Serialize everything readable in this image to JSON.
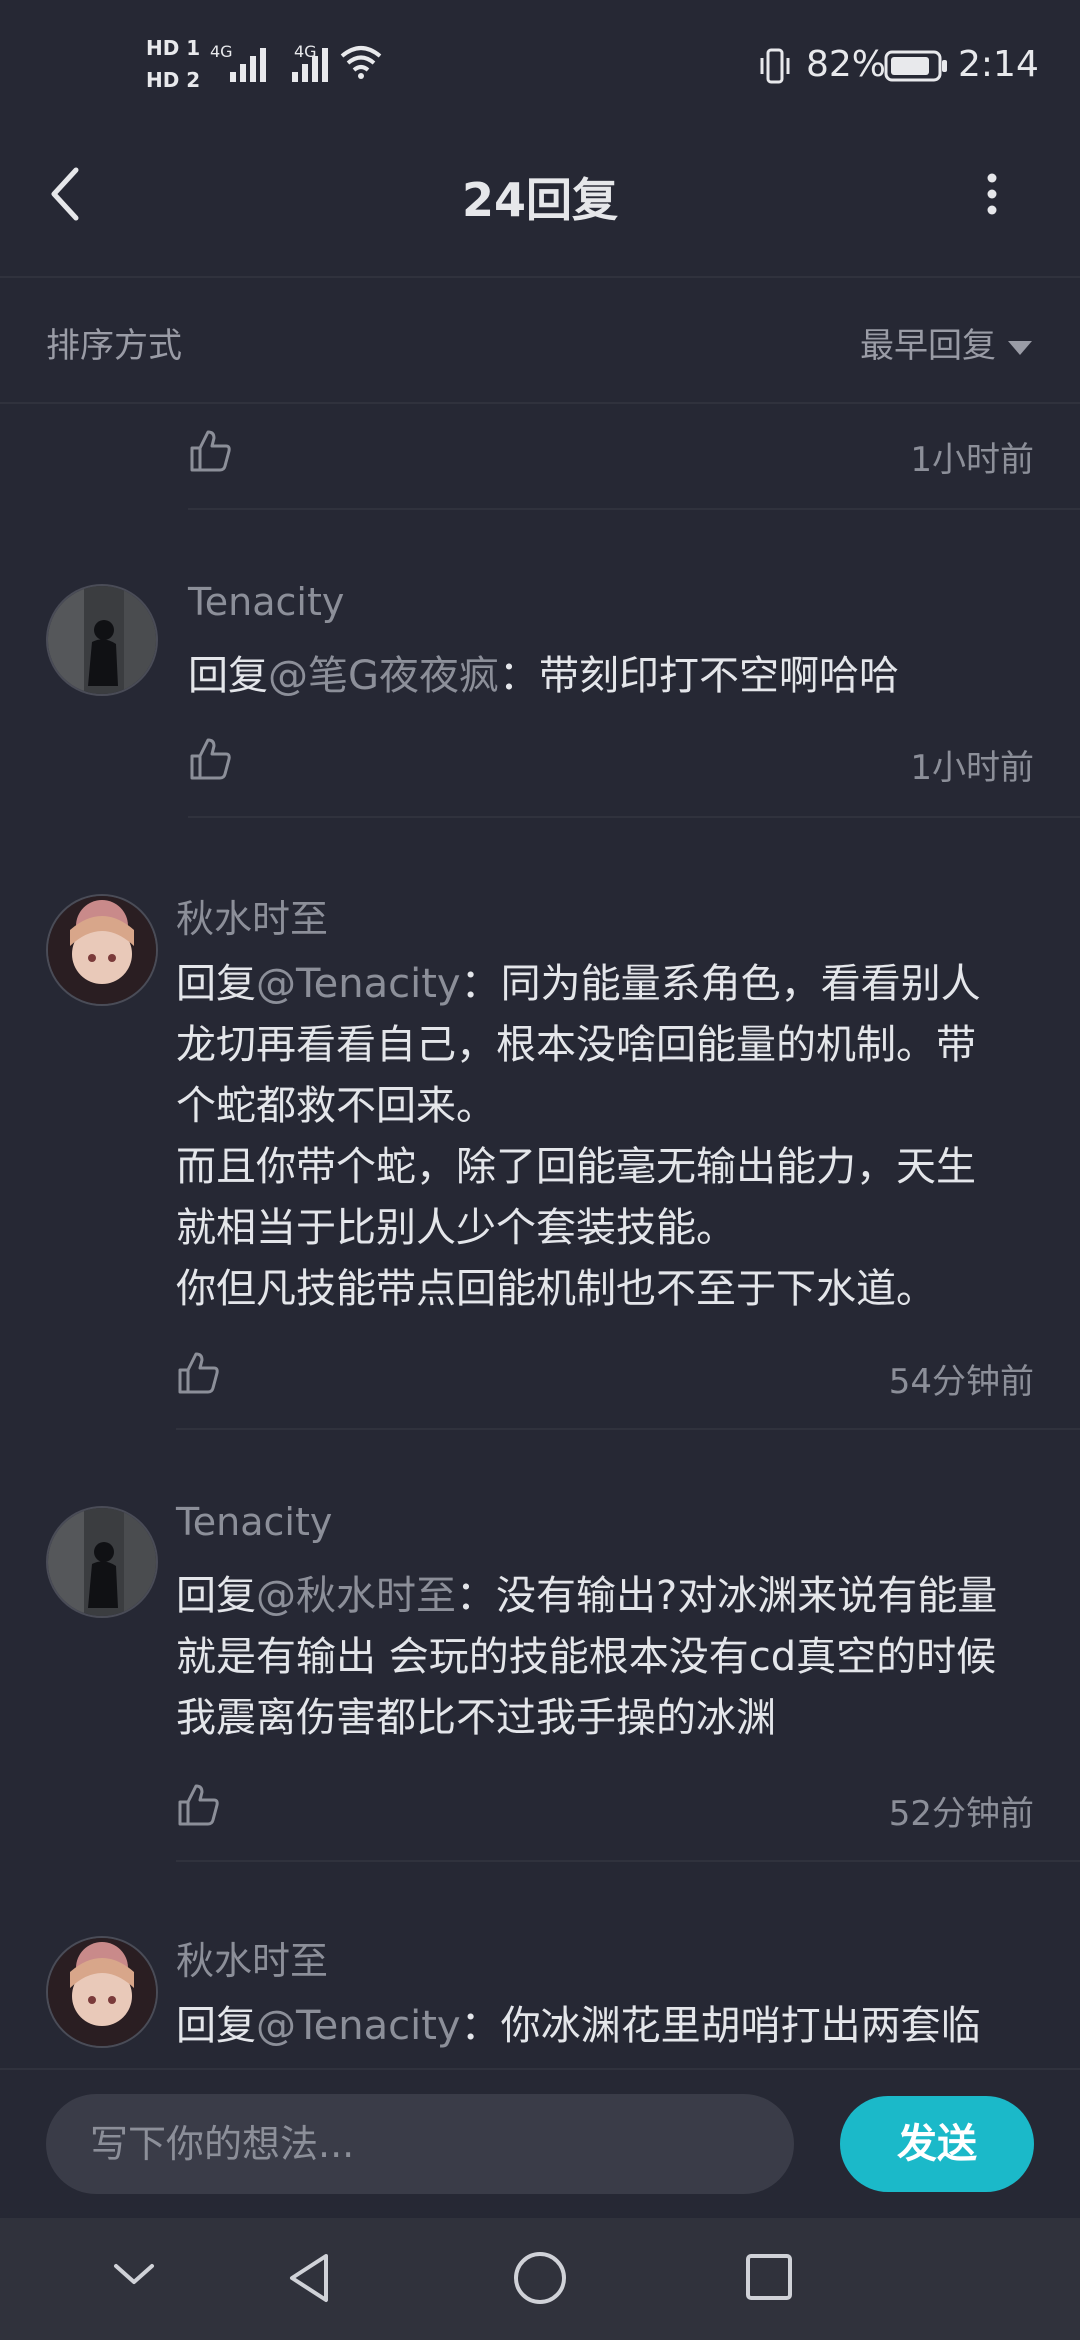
{
  "status_bar": {
    "sim1": "HD 1",
    "sim2": "HD 2",
    "net1": "4G",
    "net2": "4G",
    "battery_percent": "82%",
    "time": "2:14"
  },
  "header": {
    "title": "24回复"
  },
  "sort": {
    "label": "排序方式",
    "value": "最早回复"
  },
  "replies": [
    {
      "time": "1小时前"
    },
    {
      "name": "Tenacity",
      "prefix": "回复",
      "mention": "@笔G夜夜疯",
      "text": "：带刻印打不空啊哈哈",
      "time": "1小时前"
    },
    {
      "name": "秋水时至",
      "prefix": "回复",
      "mention": "@Tenacity",
      "text": "：同为能量系角色，看看别人\n龙切再看看自己，根本没啥回能量的机制。带\n个蛇都救不回来。\n而且你带个蛇，除了回能毫无输出能力，天生\n就相当于比别人少个套装技能。\n你但凡技能带点回能机制也不至于下水道。",
      "time": "54分钟前"
    },
    {
      "name": "Tenacity",
      "prefix": "回复",
      "mention": "@秋水时至",
      "text": "：没有输出?对冰渊来说有能量\n就是有输出 会玩的技能根本没有cd真空的时候\n我震离伤害都比不过我手操的冰渊",
      "time": "52分钟前"
    },
    {
      "name": "秋水时至",
      "prefix": "回复",
      "mention": "@Tenacity",
      "text": "：你冰渊花里胡哨打出两套临"
    }
  ],
  "composer": {
    "placeholder": "写下你的想法...",
    "send_label": "发送"
  },
  "colors": {
    "background": "#262834",
    "accent": "#1bb9c9",
    "muted": "#8c8f99"
  }
}
